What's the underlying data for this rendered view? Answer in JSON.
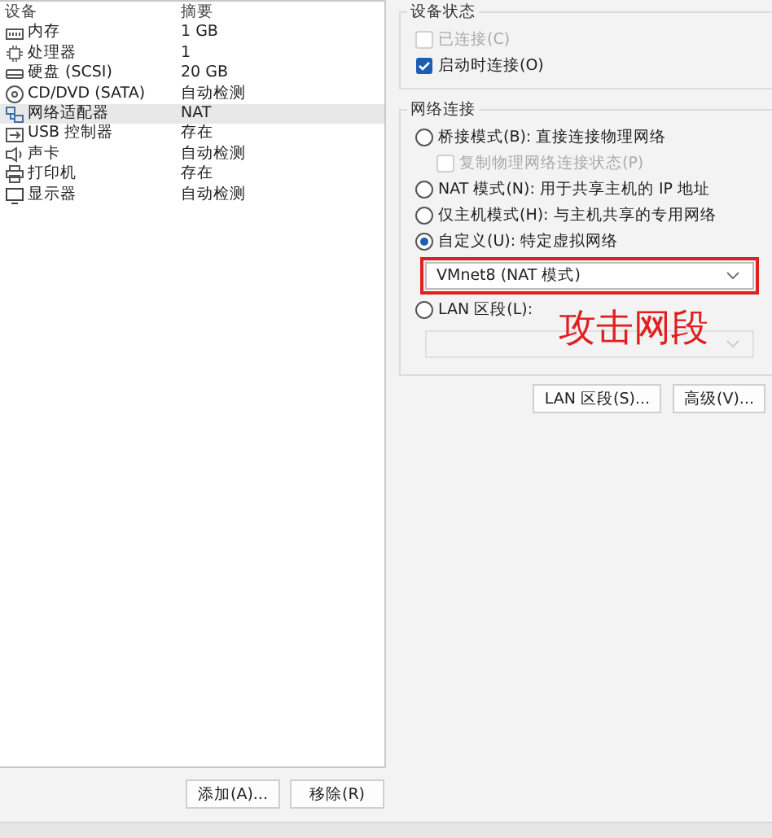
{
  "devices": {
    "columns": [
      "设备",
      "摘要"
    ],
    "rows": [
      {
        "name": "内存",
        "summary": "1 GB",
        "selected": false
      },
      {
        "name": "处理器",
        "summary": "1",
        "selected": false
      },
      {
        "name": "硬盘 (SCSI)",
        "summary": "20 GB",
        "selected": false
      },
      {
        "name": "CD/DVD (SATA)",
        "summary": "自动检测",
        "selected": false
      },
      {
        "name": "网络适配器",
        "summary": "NAT",
        "selected": true
      },
      {
        "name": "USB 控制器",
        "summary": "存在",
        "selected": false
      },
      {
        "name": "声卡",
        "summary": "自动检测",
        "selected": false
      },
      {
        "name": "打印机",
        "summary": "存在",
        "selected": false
      },
      {
        "name": "显示器",
        "summary": "自动检测",
        "selected": false
      }
    ]
  },
  "device_buttons": [
    "添加(A)...",
    "移除(R)"
  ],
  "device_status": {
    "title": "设备状态",
    "options": [
      {
        "label": "已连接(C)",
        "checked": false,
        "disabled": true
      },
      {
        "label": "启动时连接(O)",
        "checked": true,
        "disabled": false
      }
    ]
  },
  "network_connection": {
    "title": "网络连接",
    "items": [
      {
        "kind": "radio",
        "label": "桥接模式(B): 直接连接物理网络",
        "selected": false,
        "disabled": false
      },
      {
        "kind": "checkbox",
        "label": "复制物理网络连接状态(P)",
        "checked": false,
        "disabled": true
      },
      {
        "kind": "radio",
        "label": "NAT 模式(N): 用于共享主机的 IP 地址",
        "selected": false,
        "disabled": false
      },
      {
        "kind": "radio",
        "label": "仅主机模式(H): 与主机共享的专用网络",
        "selected": false,
        "disabled": false
      },
      {
        "kind": "radio",
        "label": "自定义(U): 特定虚拟网络",
        "selected": true,
        "disabled": false
      },
      {
        "kind": "dropdown",
        "value": "VMnet8 (NAT 模式)",
        "disabled": false,
        "highlighted": true
      },
      {
        "kind": "radio",
        "label": "LAN 区段(L):",
        "selected": false,
        "disabled": false
      },
      {
        "kind": "dropdown",
        "disabled": true,
        "highlighted": false
      }
    ],
    "buttons": [
      "LAN 区段(S)...",
      "高级(V)..."
    ]
  },
  "annotation": {
    "text": "攻击网段"
  }
}
